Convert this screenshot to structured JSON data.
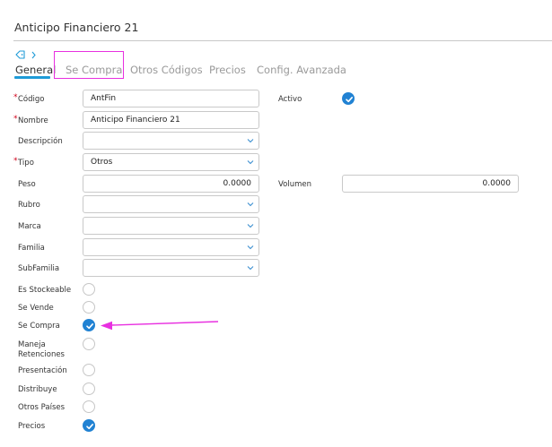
{
  "page": {
    "title": "Anticipo Financiero 21"
  },
  "breadcrumb": {
    "icon": "tag-icon",
    "separator_icon": "chevron-right-icon"
  },
  "tabs": [
    {
      "label": "General",
      "active": true
    },
    {
      "label": "Se Compra",
      "active": false
    },
    {
      "label": "Otros Códigos",
      "active": false
    },
    {
      "label": "Precios",
      "active": false
    },
    {
      "label": "Config. Avanzada",
      "active": false
    }
  ],
  "form": {
    "codigo": {
      "label": "Código",
      "required": true,
      "value": "AntFin"
    },
    "nombre": {
      "label": "Nombre",
      "required": true,
      "value": "Anticipo Financiero 21"
    },
    "descripcion": {
      "label": "Descripción",
      "required": false,
      "value": ""
    },
    "tipo": {
      "label": "Tipo",
      "required": true,
      "value": "Otros"
    },
    "peso": {
      "label": "Peso",
      "required": false,
      "value": "0.0000"
    },
    "rubro": {
      "label": "Rubro",
      "required": false,
      "value": ""
    },
    "marca": {
      "label": "Marca",
      "required": false,
      "value": ""
    },
    "familia": {
      "label": "Familia",
      "required": false,
      "value": ""
    },
    "subfamilia": {
      "label": "SubFamilia",
      "required": false,
      "value": ""
    },
    "activo": {
      "label": "Activo",
      "checked": true
    },
    "volumen": {
      "label": "Volumen",
      "value": "0.0000"
    },
    "es_stockeable": {
      "label": "Es Stockeable",
      "checked": false
    },
    "se_vende": {
      "label": "Se Vende",
      "checked": false
    },
    "se_compra": {
      "label": "Se Compra",
      "checked": true
    },
    "maneja_retenciones": {
      "label_line1": "Maneja",
      "label_line2": "Retenciones",
      "checked": false
    },
    "presentacion": {
      "label": "Presentación",
      "checked": false
    },
    "distribuye": {
      "label": "Distribuye",
      "checked": false
    },
    "otros_paises": {
      "label": "Otros Países",
      "checked": false
    },
    "precios": {
      "label": "Precios",
      "checked": true
    }
  },
  "colors": {
    "accent": "#1f9bd7",
    "checkbox_on": "#2182d3",
    "required": "#d0021b",
    "annotation": "#e830e0"
  }
}
